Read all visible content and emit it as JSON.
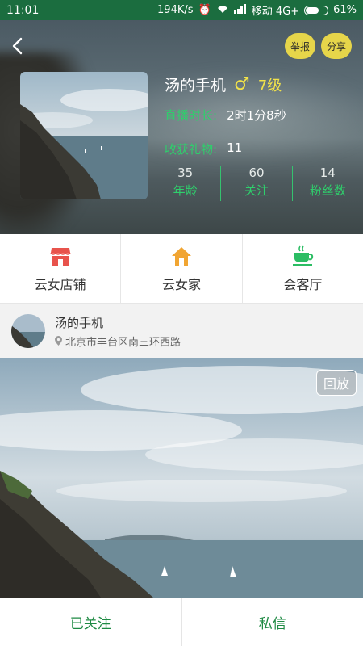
{
  "status_bar": {
    "time": "11:01",
    "speed": "194K/s",
    "carrier": "移动 4G+",
    "battery": "61%",
    "battery_level": 0.61
  },
  "header": {
    "report_label": "举报",
    "share_label": "分享",
    "name": "汤的手机",
    "gender_icon": "male-icon",
    "gender_symbol": "♂",
    "level": "7级",
    "live_label": "直播时长:",
    "live_value": "2时1分8秒",
    "gift_label": "收获礼物:",
    "gift_value": "11",
    "stats": [
      {
        "num": "35",
        "label": "年龄"
      },
      {
        "num": "60",
        "label": "关注"
      },
      {
        "num": "14",
        "label": "粉丝数"
      }
    ]
  },
  "tiles": [
    {
      "label": "云女店铺",
      "icon": "store-icon",
      "color": "#e8534c"
    },
    {
      "label": "云女家",
      "icon": "home-icon",
      "color": "#f1a532"
    },
    {
      "label": "会客厅",
      "icon": "tea-cup-icon",
      "color": "#2bbd63"
    }
  ],
  "location": {
    "name": "汤的手机",
    "address": "北京市丰台区南三环西路"
  },
  "video": {
    "replay_label": "回放"
  },
  "bottom": {
    "follow_label": "已关注",
    "message_label": "私信"
  },
  "colors": {
    "status_bar": "#1b6d3f",
    "accent_green": "#2fcf6c",
    "accent_yellow": "#f1e24a",
    "bottom_text": "#1e8a43"
  }
}
